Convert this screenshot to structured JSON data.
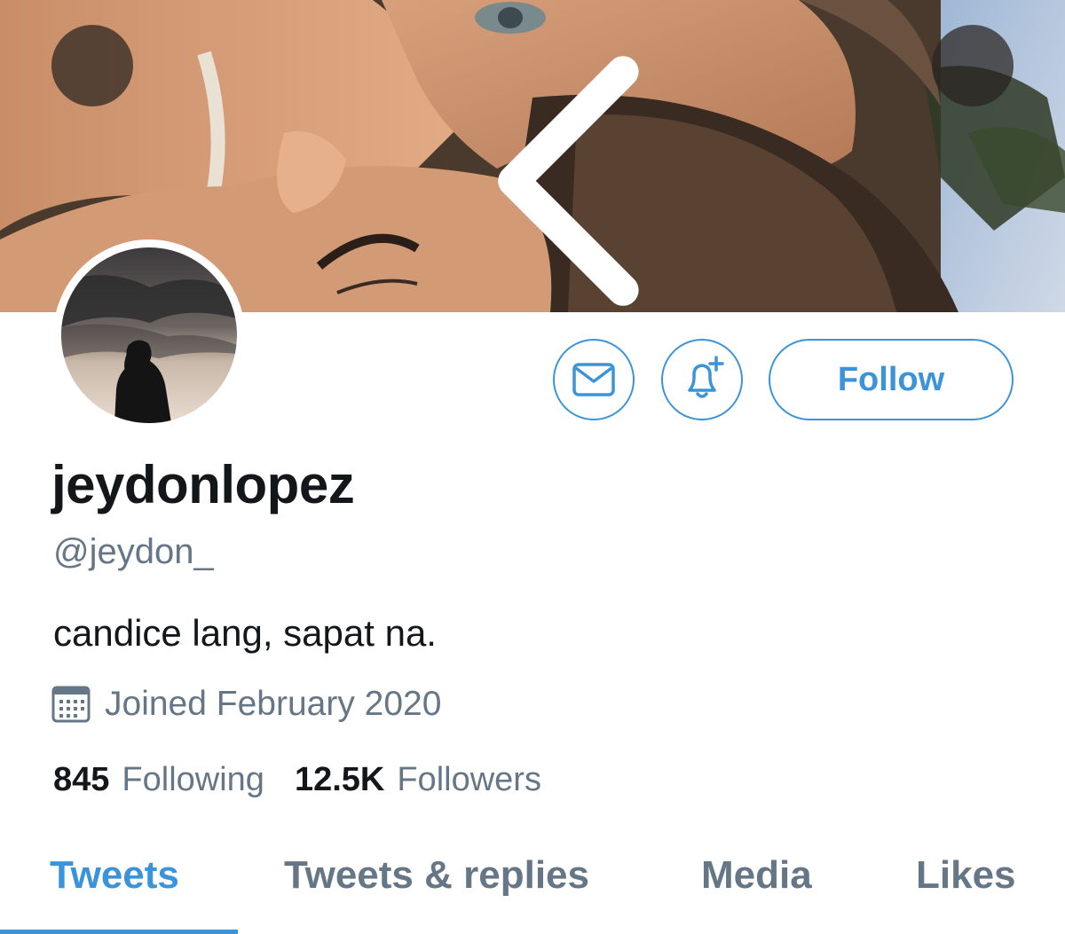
{
  "header": {
    "back_icon": "chevron-left-icon",
    "more_icon": "more-dots-icon"
  },
  "profile": {
    "display_name": "jeydonlopez",
    "handle": "@jeydon_",
    "bio": "candice lang, sapat na.",
    "joined": "Joined February 2020",
    "joined_icon": "calendar-icon"
  },
  "actions": {
    "message_icon": "envelope-icon",
    "notify_icon": "bell-plus-icon",
    "follow_label": "Follow"
  },
  "stats": {
    "following_count": "845",
    "following_label": "Following",
    "followers_count": "12.5K",
    "followers_label": "Followers"
  },
  "tabs": [
    {
      "label": "Tweets",
      "active": true
    },
    {
      "label": "Tweets & replies",
      "active": false
    },
    {
      "label": "Media",
      "active": false
    },
    {
      "label": "Likes",
      "active": false
    }
  ],
  "colors": {
    "accent": "#3b94d9",
    "secondary_text": "#657786",
    "primary_text": "#14171a"
  }
}
